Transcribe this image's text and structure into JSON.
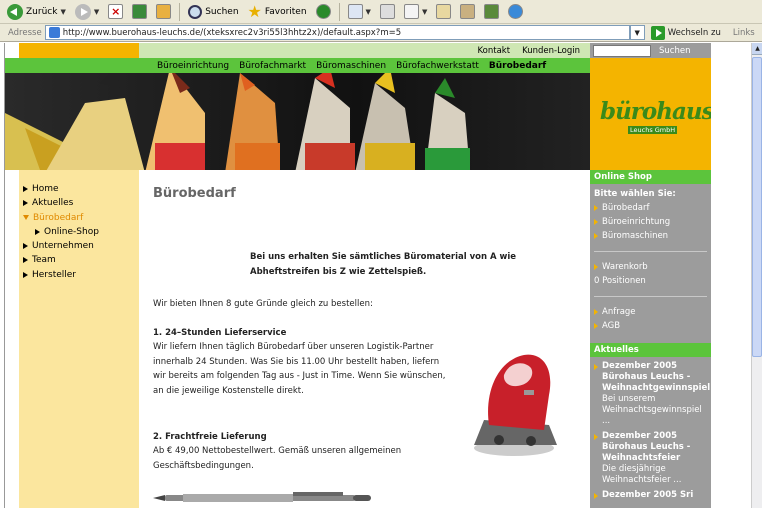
{
  "browser": {
    "back_label": "Zurück",
    "search_label": "Suchen",
    "favorites_label": "Favoriten",
    "address_label": "Adresse",
    "url": "http://www.buerohaus-leuchs.de/(xteksxrec2v3ri55l3hhtz2x)/default.aspx?m=5",
    "go_label": "Wechseln zu",
    "links_label": "Links"
  },
  "site": {
    "utility_links": [
      "Kontakt",
      "Kunden-Login"
    ],
    "search_button": "Suchen",
    "nav": [
      "Büroeinrichtung",
      "Bürofachmarkt",
      "Büromaschinen",
      "Bürofachwerkstatt",
      "Bürobedarf"
    ],
    "logo_text": "bürohaus",
    "logo_sub": "Leuchs GmbH",
    "left_nav": [
      {
        "label": "Home"
      },
      {
        "label": "Aktuelles"
      },
      {
        "label": "Bürobedarf"
      },
      {
        "label": "Online-Shop"
      },
      {
        "label": "Unternehmen"
      },
      {
        "label": "Team"
      },
      {
        "label": "Hersteller"
      }
    ],
    "page_title": "Bürobedarf",
    "intro": "Bei uns erhalten Sie sämtliches Büromaterial von A wie Abheftstreifen bis Z wie Zettelspieß.",
    "lead": "Wir bieten Ihnen 8 gute Gründe gleich zu bestellen:",
    "reason1_title": "1. 24–Stunden Lieferservice",
    "reason1_text": "Wir liefern Ihnen täglich Bürobedarf über unseren Logistik-Partner innerhalb 24 Stunden. Was Sie bis 11.00 Uhr bestellt haben, liefern wir bereits am folgenden Tag aus - Just in Time. Wenn Sie wünschen, an die jeweilige Kostenstelle direkt.",
    "reason2_title": "2. Frachtfreie Lieferung",
    "reason2_text": "Ab € 49,00 Nettobestellwert. Gemäß unseren allgemeinen Geschäftsbedingungen.",
    "shop": {
      "header": "Online Shop",
      "prompt": "Bitte wählen Sie:",
      "items": [
        "Bürobedarf",
        "Büroeinrichtung",
        "Büromaschinen"
      ],
      "cart": "Warenkorb",
      "positions": "0 Positionen",
      "extra": [
        "Anfrage",
        "AGB"
      ]
    },
    "news": {
      "header": "Aktuelles",
      "items": [
        {
          "title": "Dezember 2005 Bürohaus Leuchs - Weihnachtgewinnspiel",
          "text": "Bei unserem Weihnachtsgewinnspiel ..."
        },
        {
          "title": "Dezember 2005 Bürohaus Leuchs - Weihnachtsfeier",
          "text": "Die diesjährige Weihnachtsfeier ..."
        },
        {
          "title": "Dezember 2005 Sri",
          "text": ""
        }
      ]
    }
  },
  "colors": {
    "green": "#5cc43c",
    "orange": "#f4b400",
    "light_yellow": "#fbe69e",
    "gray": "#9c9c9c"
  }
}
